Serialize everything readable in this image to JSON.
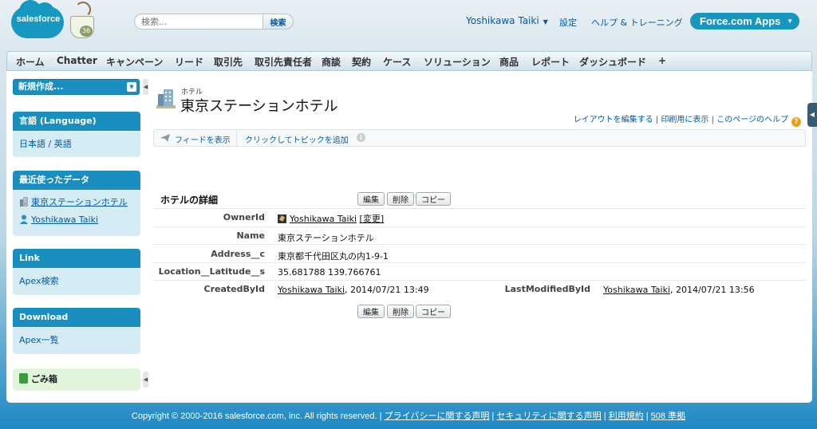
{
  "header": {
    "logo_text": "salesforce",
    "mascot_number": "36",
    "search_placeholder": "検索...",
    "search_button": "検索",
    "user_name": "Yoshikawa Taiki",
    "setup": "設定",
    "help_training": "ヘルプ & トレーニング",
    "app_menu": "Force.com Apps"
  },
  "tabs": [
    "ホーム",
    "Chatter",
    "キャンペーン",
    "リード",
    "取引先",
    "取引先責任者",
    "商談",
    "契約",
    "ケース",
    "ソリューション",
    "商品",
    "レポート",
    "ダッシュボード",
    "+"
  ],
  "sidebar": {
    "create_new": "新規作成...",
    "language": {
      "header": "言語 (Language)",
      "items": [
        "日本語 / 英語"
      ]
    },
    "recent": {
      "header": "最近使ったデータ",
      "items": [
        "東京ステーションホテル",
        "Yoshikawa Taiki"
      ]
    },
    "link": {
      "header": "Link",
      "items": [
        "Apex検索"
      ]
    },
    "download": {
      "header": "Download",
      "items": [
        "Apex一覧"
      ]
    },
    "recycle_bin": "ごみ箱"
  },
  "record": {
    "object_type": "ホテル",
    "title": "東京ステーションホテル",
    "top_links": [
      "レイアウトを編集する",
      "印刷用に表示",
      "このページのヘルプ"
    ],
    "feed_show": "フィードを表示",
    "add_topic": "クリックしてトピックを追加",
    "section_title": "ホテルの詳細",
    "buttons": {
      "edit": "編集",
      "delete": "削除",
      "copy": "コピー"
    },
    "fields": {
      "owner_label": "OwnerId",
      "owner_value": "Yoshikawa Taiki",
      "owner_change": "[変更]",
      "name_label": "Name",
      "name_value": "東京ステーションホテル",
      "address_label": "Address__c",
      "address_value": "東京都千代田区丸の内1-9-1",
      "location_label": "Location__Latitude__s",
      "location_value": "35.681788 139.766761",
      "created_label": "CreatedById",
      "created_user": "Yoshikawa Taiki",
      "created_date": ", 2014/07/21 13:49",
      "modified_label": "LastModifiedById",
      "modified_user": "Yoshikawa Taiki",
      "modified_date": ", 2014/07/21 13:56"
    }
  },
  "footer": {
    "copyright": "Copyright © 2000-2016 salesforce.com, inc. All rights reserved. |",
    "links": [
      "プライバシーに関する声明",
      "セキュリティに関する声明",
      "利用規約",
      "508 準拠"
    ]
  }
}
